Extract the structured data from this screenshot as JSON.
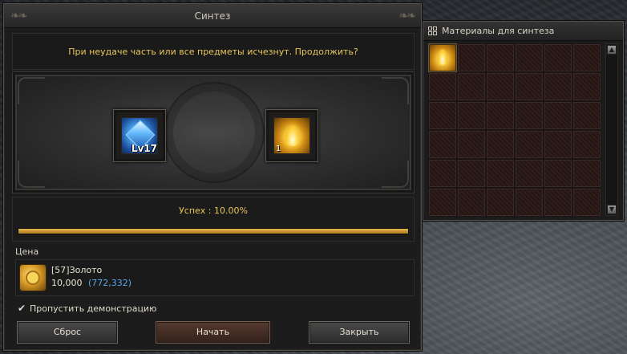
{
  "synthesis_window": {
    "title": "Синтез",
    "warning": "При неудаче часть или все предметы исчезнут. Продолжить?",
    "slot_left": {
      "icon": "blue-gem-icon",
      "level_label": "Lv17"
    },
    "slot_right": {
      "icon": "flame-crystal-icon",
      "count": "1"
    },
    "success_label": "Успех : 10.00%",
    "progress_fraction": 1.0,
    "price": {
      "label": "Цена",
      "item_name": "[57]Золото",
      "amount": "10,000",
      "owned": "(772,332)"
    },
    "skip_demo_label": "Пропустить демонстрацию",
    "skip_demo_checked": true,
    "buttons": {
      "reset": "Сброс",
      "start": "Начать",
      "close": "Закрыть"
    }
  },
  "materials_panel": {
    "title": "Материалы для синтеза",
    "rows": 6,
    "cols": 6,
    "items": [
      {
        "index": 0,
        "icon": "flame-crystal-icon"
      }
    ],
    "scroll_up": "▲",
    "scroll_down": "▼"
  },
  "colors": {
    "gold_text": "#e7c65b",
    "progress": "#e8b64a",
    "owned_blue": "#5aa8e8"
  }
}
